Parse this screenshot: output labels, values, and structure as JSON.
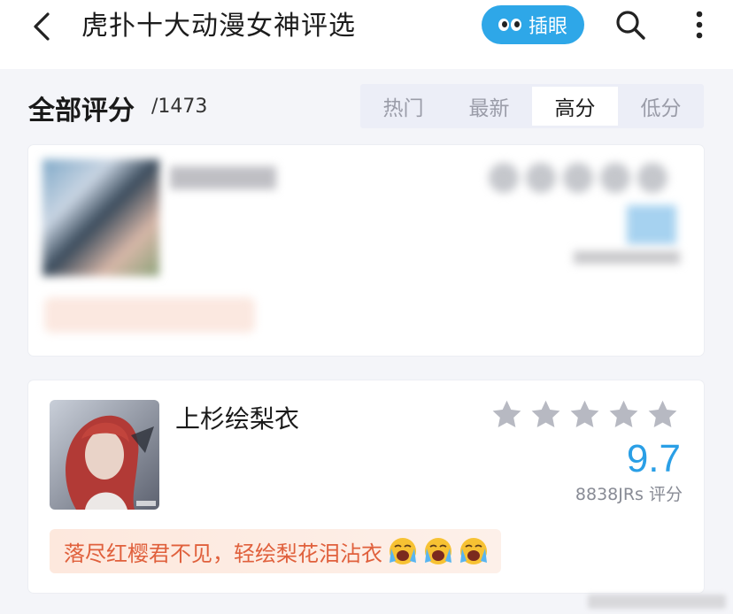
{
  "header": {
    "title": "虎扑十大动漫女神评选",
    "chayan_label": "插眼"
  },
  "section": {
    "title": "全部评分",
    "count": "/1473"
  },
  "tabs": [
    {
      "label": "热门",
      "active": false
    },
    {
      "label": "最新",
      "active": false
    },
    {
      "label": "高分",
      "active": true
    },
    {
      "label": "低分",
      "active": false
    }
  ],
  "items": [
    {
      "name": "",
      "score": "",
      "rating_count": "",
      "comment": "",
      "blurred": true
    },
    {
      "name": "上杉绘梨衣",
      "stars": 5,
      "score": "9.7",
      "rating_count": "8838JRs 评分",
      "comment": "落尽红樱君不见，轻绘梨花泪沾衣",
      "blurred": false
    }
  ],
  "colors": {
    "accent": "#2ea7e8",
    "score": "#2a9fe6",
    "comment_text": "#e0603c",
    "comment_bg": "#fde8dd"
  },
  "icons": [
    "back-icon",
    "eyes-icon",
    "search-icon",
    "more-icon",
    "star-icon",
    "crying-face-icon"
  ]
}
